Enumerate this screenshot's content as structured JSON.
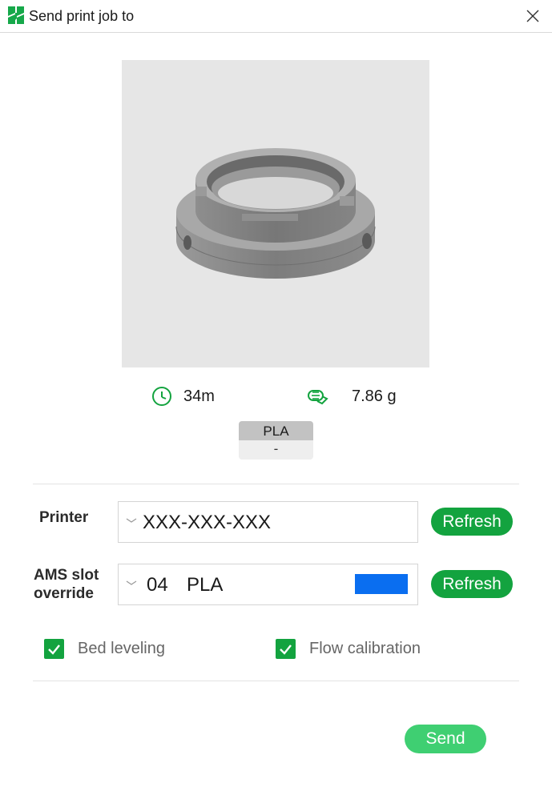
{
  "window": {
    "title": "Send print job to",
    "logo_icon": "bambu-logo-icon",
    "close_icon": "close-icon"
  },
  "preview": {
    "background_color": "#e6e6e6",
    "model_color": "#8a8a8a"
  },
  "stats": {
    "time_icon": "clock-icon",
    "time_value": "34m",
    "weight_icon": "filament-spool-icon",
    "weight_value": "7.86 g"
  },
  "filament": {
    "type": "PLA",
    "slot": "-"
  },
  "printer": {
    "label": "Printer",
    "value": "XXX-XXX-XXX",
    "refresh_label": "Refresh"
  },
  "ams": {
    "label_line1": "AMS slot",
    "label_line2": "override",
    "slot_number": "04",
    "slot_material": "PLA",
    "slot_color": "#0a6ef0",
    "refresh_label": "Refresh"
  },
  "options": {
    "bed_leveling": {
      "label": "Bed leveling",
      "checked": true
    },
    "flow_calibration": {
      "label": "Flow calibration",
      "checked": true
    }
  },
  "colors": {
    "accent": "#13a33f",
    "send_button": "#3fcf72"
  },
  "send_label": "Send"
}
